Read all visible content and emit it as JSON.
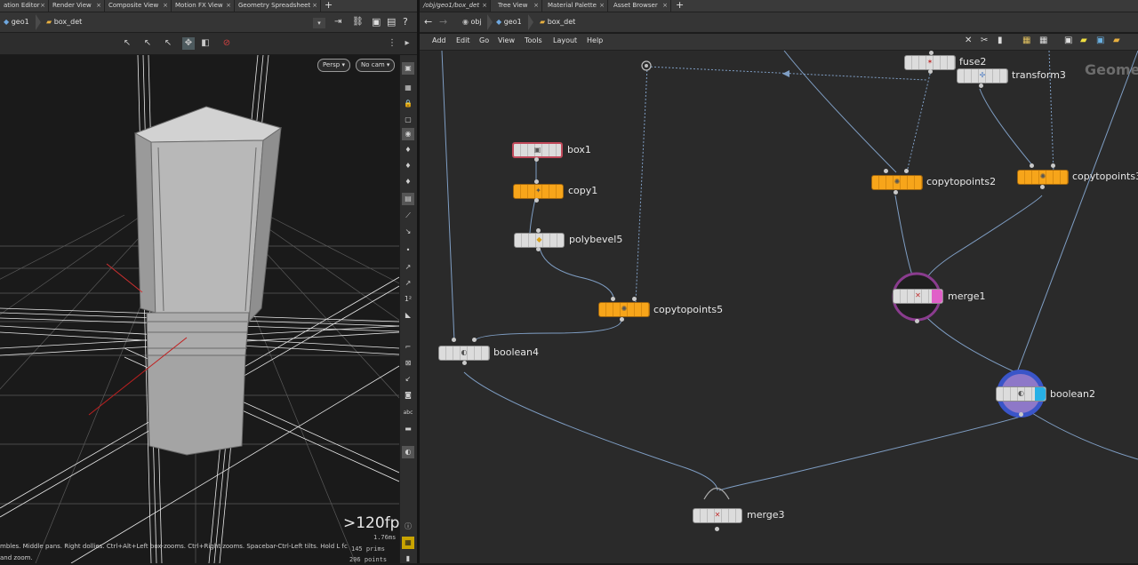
{
  "left_tabs": [
    "ation Editor",
    "Render View",
    "Composite View",
    "Motion FX View",
    "Geometry Spreadsheet"
  ],
  "right_tabs": [
    "/obj/geo1/box_det",
    "Tree View",
    "Material Palette",
    "Asset Browser"
  ],
  "left_path": [
    "geo1",
    "box_det"
  ],
  "right_path": [
    "obj",
    "geo1",
    "box_det"
  ],
  "viewport": {
    "camera_btn": "Persp",
    "cam_select": "No cam",
    "fps": ">120fps",
    "stat_ms": "1.76ms",
    "stat_prims": "145  prims",
    "stat_points": "206  points",
    "hint_line1": "mbles. Middle pans. Right dollies. Ctrl+Alt+Left box-zooms. Ctrl+Right zooms. Spacebar-Ctrl-Left tilts. Hold L fc",
    "hint_line2": "and zoom."
  },
  "menu": [
    "Add",
    "Edit",
    "Go",
    "View",
    "Tools",
    "Layout",
    "Help"
  ],
  "network_label": "Geome",
  "nodes": {
    "box1": "box1",
    "copy1": "copy1",
    "polybevel5": "polybevel5",
    "copytopoints5": "copytopoints5",
    "boolean4": "boolean4",
    "fuse": "fuse2",
    "transform3": "transform3",
    "copytopoints2": "copytopoints2",
    "copytopoints3": "copytopoints3",
    "merge1": "merge1",
    "boolean2": "boolean2",
    "merge3": "merge3"
  },
  "colors": {
    "orange_node": "#f7a51a",
    "grey_node": "#dcdcdc",
    "wire": "#7f9ec4",
    "merge1_ring": "#8a3c8e",
    "boolean2_ring": "#3a55c8",
    "boolean2_flag": "#27b0e6",
    "merge1_flag": "#e060c8"
  }
}
